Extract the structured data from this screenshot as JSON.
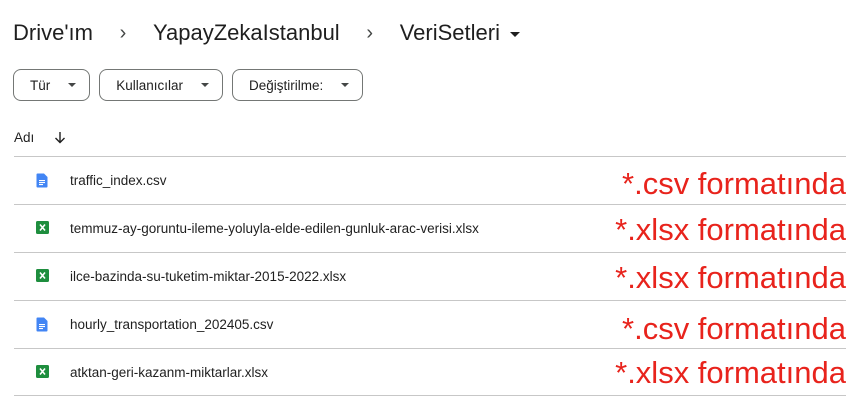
{
  "breadcrumb": {
    "items": [
      "Drive'ım",
      "YapayZekaIstanbul"
    ],
    "separator": "›",
    "current": "VeriSetleri"
  },
  "filters": [
    {
      "label": "Tür"
    },
    {
      "label": "Kullanıcılar"
    },
    {
      "label": "Değiştirilme:"
    }
  ],
  "list": {
    "column_header": "Adı",
    "sort_icon": "arrow-down-icon",
    "files": [
      {
        "name": "traffic_index.csv",
        "type": "docs",
        "icon": "docs-file-icon",
        "note": "*.csv formatında"
      },
      {
        "name": "temmuz-ay-goruntu-ileme-yoluyla-elde-edilen-gunluk-arac-verisi.xlsx",
        "type": "sheets",
        "icon": "sheets-file-icon",
        "note": "*.xlsx formatında"
      },
      {
        "name": "ilce-bazinda-su-tuketim-miktar-2015-2022.xlsx",
        "type": "sheets",
        "icon": "sheets-file-icon",
        "note": "*.xlsx formatında"
      },
      {
        "name": "hourly_transportation_202405.csv",
        "type": "docs",
        "icon": "docs-file-icon",
        "note": "*.csv formatında"
      },
      {
        "name": "atktan-geri-kazanm-miktarlar.xlsx",
        "type": "sheets",
        "icon": "sheets-file-icon",
        "note": "*.xlsx formatında"
      }
    ]
  },
  "colors": {
    "docs_blue": "#4285f4",
    "sheets_green": "#1e8e3e",
    "annotation_red": "#e8231c",
    "divider": "#c7c7c7"
  }
}
